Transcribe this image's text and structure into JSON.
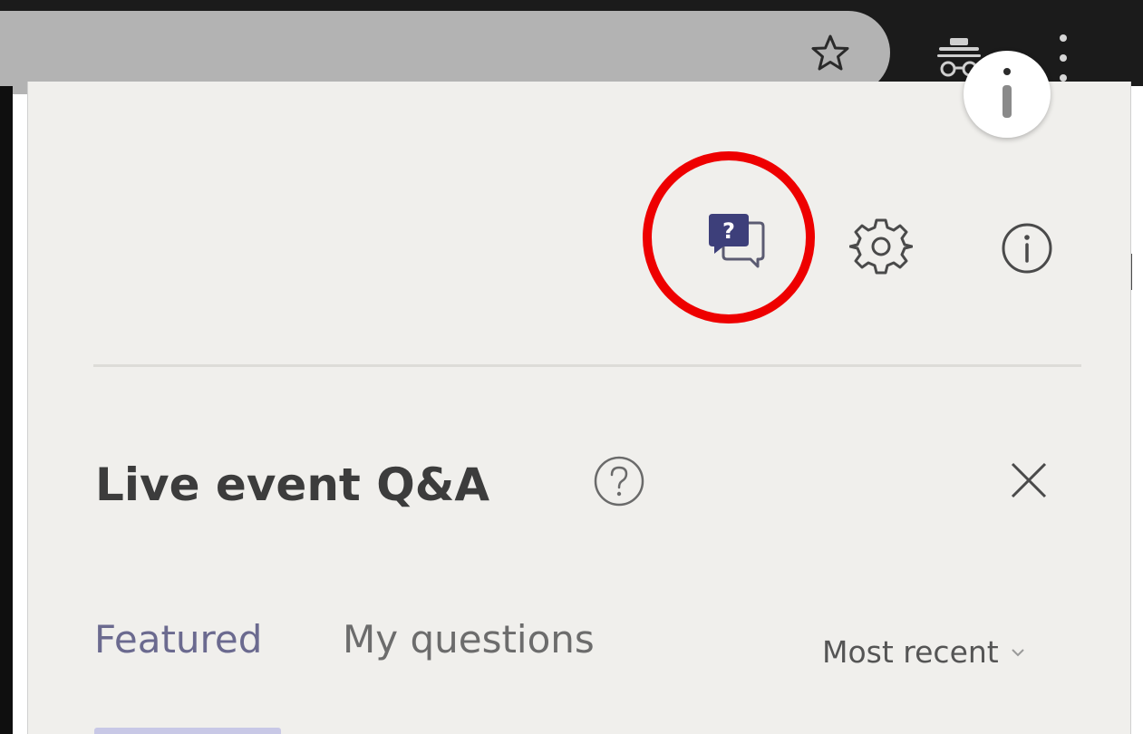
{
  "browser": {
    "icons": [
      "star-icon",
      "incognito-icon",
      "kebab-menu-icon"
    ]
  },
  "panel": {
    "toolbar_icons": [
      "qa-chat-icon",
      "gear-icon",
      "info-icon"
    ],
    "title": "Live event Q&A",
    "tabs": [
      {
        "label": "Featured",
        "active": true
      },
      {
        "label": "My questions",
        "active": false
      }
    ],
    "sort": {
      "selected": "Most recent"
    }
  },
  "colors": {
    "highlight_ring": "#ee0000",
    "qa_icon": "#3d3f7a",
    "panel_bg": "#f0efec",
    "active_tab": "#6b6a8f"
  }
}
